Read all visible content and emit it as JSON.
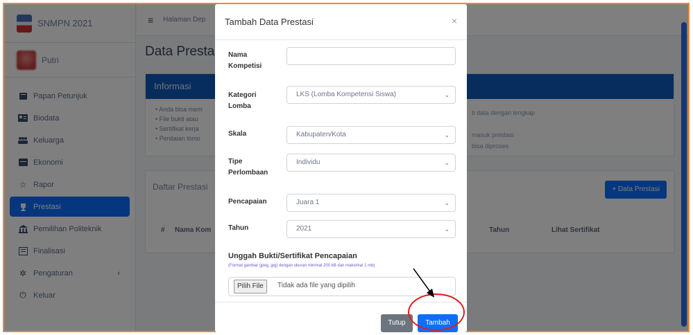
{
  "brand": {
    "name": "SNMPN 2021"
  },
  "user": {
    "name": "Putri"
  },
  "sidebar": {
    "items": [
      {
        "label": "Papan Petunjuk",
        "icon": "book-icon"
      },
      {
        "label": "Biodata",
        "icon": "id-card-icon"
      },
      {
        "label": "Keluarga",
        "icon": "users-icon"
      },
      {
        "label": "Ekonomi",
        "icon": "money-icon"
      },
      {
        "label": "Rapor",
        "icon": "star-icon"
      },
      {
        "label": "Prestasi",
        "icon": "trophy-icon"
      },
      {
        "label": "Pemilihan Politeknik",
        "icon": "university-icon"
      },
      {
        "label": "Finalisasi",
        "icon": "finalize-icon"
      },
      {
        "label": "Pengaturan",
        "icon": "gear-icon"
      },
      {
        "label": "Keluar",
        "icon": "power-icon"
      }
    ],
    "active_index": 5
  },
  "topbar": {
    "breadcrumb": "Halaman Dep"
  },
  "page": {
    "title": "Data Prestas"
  },
  "info": {
    "title": "Informasi",
    "bullets": [
      "Anda bisa mem",
      "File bukti atau",
      "Sertifikat kerja",
      "Penilaian lomo"
    ],
    "right_lines": [
      "ti data dengan lengkap",
      "",
      "masuk prestasi",
      "bisa diproses"
    ]
  },
  "list": {
    "title": "Daftar Prestasi",
    "add_button": "+ Data Prestasi",
    "columns": {
      "num": "#",
      "name": "Nama Kom",
      "tahun": "Tahun",
      "sertifikat": "Lihat Sertifikat"
    }
  },
  "modal": {
    "title": "Tambah Data Prestasi",
    "close": "×",
    "fields": {
      "nama_kompetisi": {
        "label": "Nama Kompetisi",
        "value": ""
      },
      "kategori_lomba": {
        "label": "Kategori Lomba",
        "value": "LKS (Lomba Kompetensi Siswa)"
      },
      "skala": {
        "label": "Skala",
        "value": "Kabupaten/Kota"
      },
      "tipe_perlombaan": {
        "label": "Tipe Perlombaan",
        "value": "Individu"
      },
      "pencapaian": {
        "label": "Pencapaian",
        "value": "Juara 1"
      },
      "tahun": {
        "label": "Tahun",
        "value": "2021"
      }
    },
    "upload": {
      "title": "Unggah Bukti/Sertifikat Pencapaian",
      "hint": "(Format gambar (jpeg, jpg) dengan ukuran minimal 200 kB dan maksimal 1 mb)",
      "button": "Pilih File",
      "status": "Tidak ada file yang dipilih"
    },
    "buttons": {
      "close": "Tutup",
      "submit": "Tambah"
    }
  },
  "colors": {
    "primary": "#0d6efd",
    "header": "#0d5bbd",
    "highlight": "#e21d1d",
    "frame": "#e8893a"
  }
}
